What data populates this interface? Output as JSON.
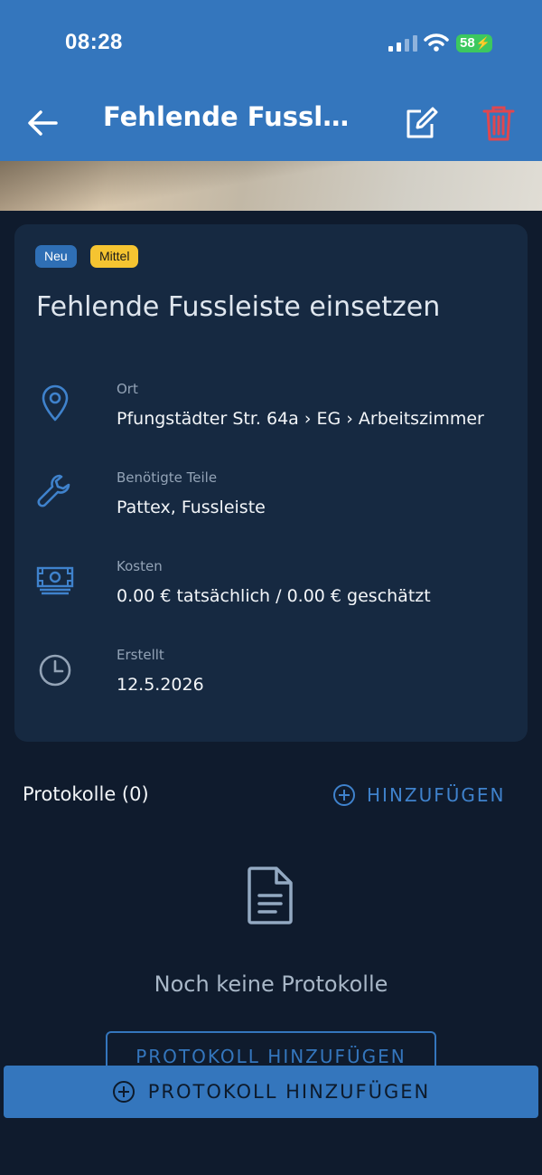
{
  "status_bar": {
    "time": "08:28",
    "battery": "58"
  },
  "header": {
    "title": "Fehlende Fussl…",
    "back_icon": "arrow-left-icon",
    "edit_icon": "edit-icon",
    "delete_icon": "trash-icon"
  },
  "card": {
    "badges": {
      "status": "Neu",
      "priority": "Mittel"
    },
    "title": "Fehlende Fussleiste einsetzen",
    "location": {
      "label": "Ort",
      "value": "Pfungstädter Str. 64a › EG › Arbeitszimmer",
      "icon": "location-pin-icon"
    },
    "parts": {
      "label": "Benötigte Teile",
      "value": "Pattex, Fussleiste",
      "icon": "wrench-icon"
    },
    "costs": {
      "label": "Kosten",
      "value": "0.00 € tatsächlich / 0.00 € geschätzt",
      "icon": "money-icon"
    },
    "created": {
      "label": "Erstellt",
      "value": "12.5.2026",
      "icon": "clock-icon"
    }
  },
  "protocols": {
    "title": "Protokolle (0)",
    "add_label": "HINZUFÜGEN",
    "empty_text": "Noch keine Protokolle",
    "outline_button_label": "PROTOKOLL HINZUFÜGEN"
  },
  "bottom_button": {
    "label": "PROTOKOLL HINZUFÜGEN"
  },
  "colors": {
    "header": "#3476bd",
    "background": "#0f1b2d",
    "card": "#162941",
    "accent": "#3f82cc",
    "delete": "#e0474f",
    "badge_new": "#2f6fb5",
    "badge_priority": "#f5c431"
  }
}
